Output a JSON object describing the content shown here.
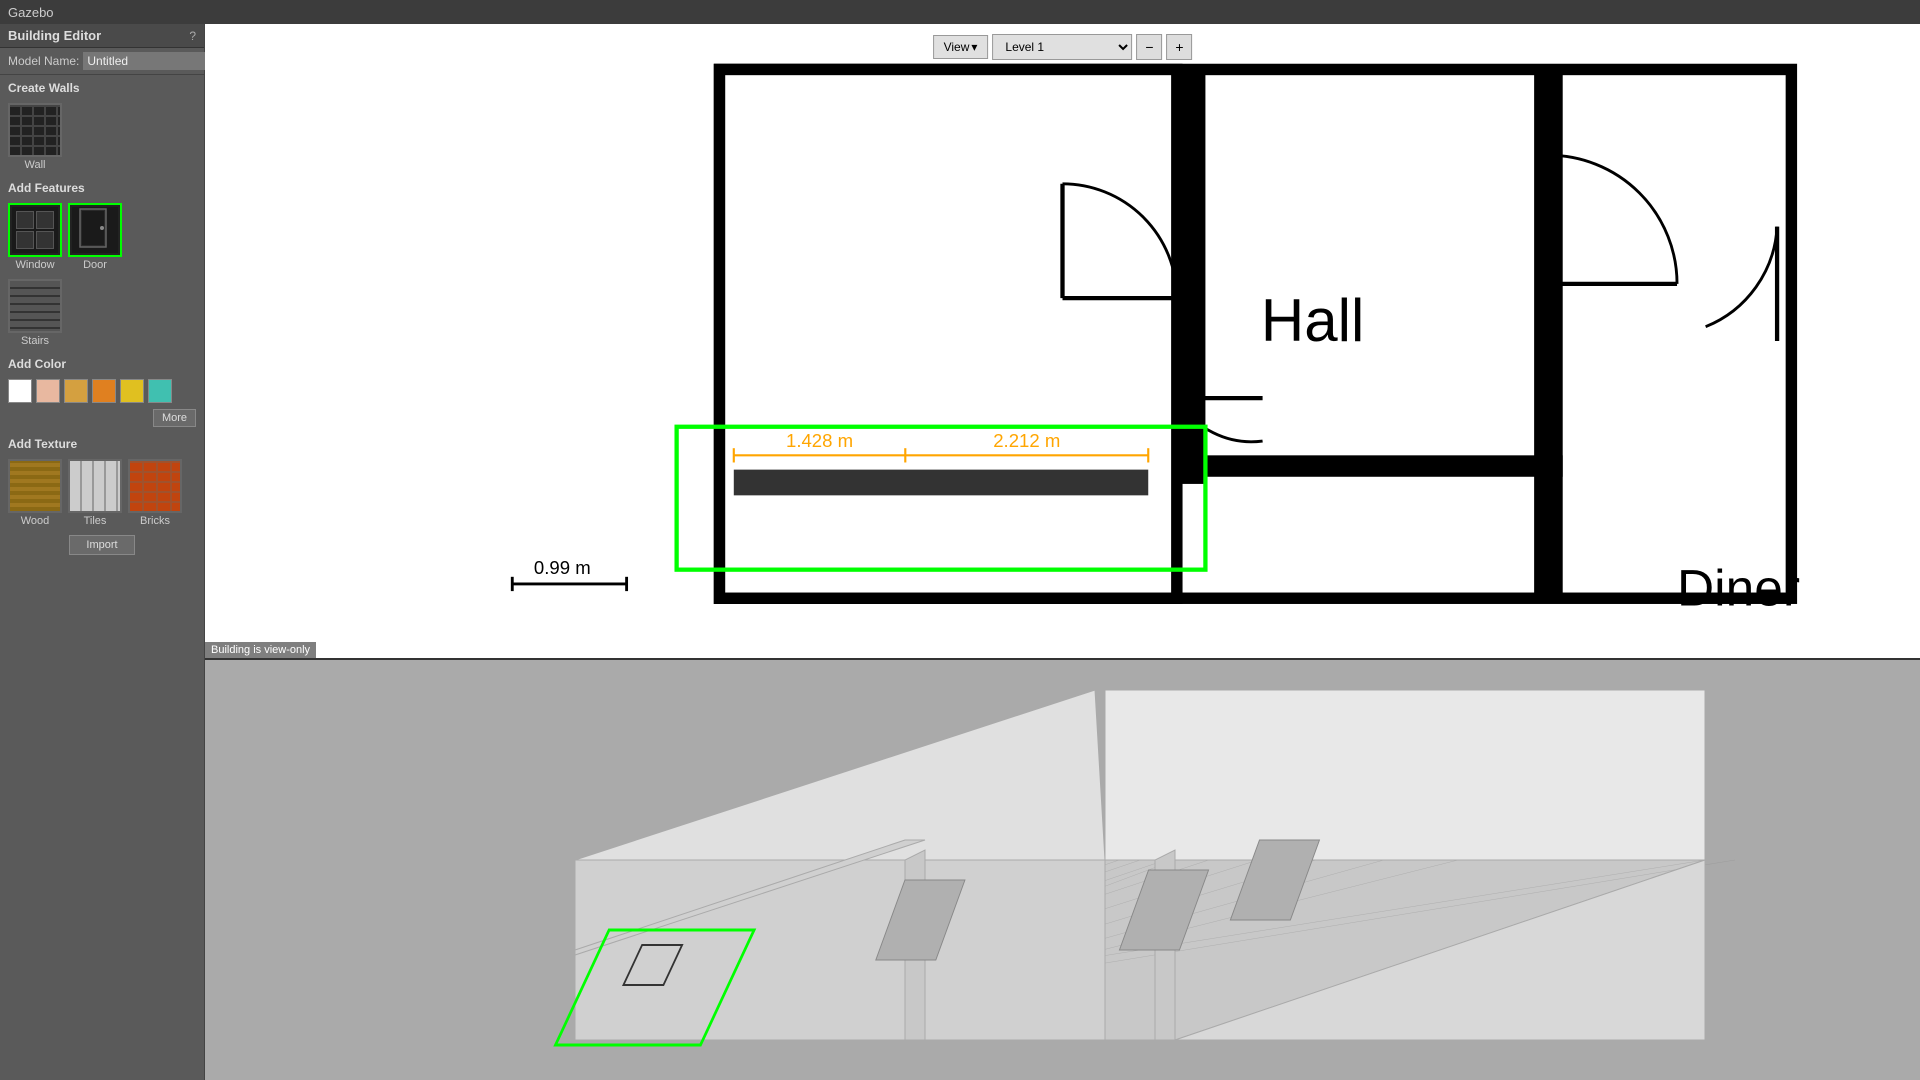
{
  "titlebar": {
    "app_name": "Gazebo"
  },
  "sidebar": {
    "title": "Building Editor",
    "help_label": "?",
    "model_name_label": "Model Name:",
    "model_name_value": "Untitled",
    "sections": {
      "create_walls": "Create Walls",
      "wall_label": "Wall",
      "add_features": "Add Features",
      "window_label": "Window",
      "door_label": "Door",
      "stairs_label": "Stairs",
      "add_color": "Add Color",
      "more_label": "More",
      "add_texture": "Add Texture",
      "wood_label": "Wood",
      "tiles_label": "Tiles",
      "bricks_label": "Bricks",
      "import_label": "Import"
    },
    "colors": [
      "#ffffff",
      "#e8b8a0",
      "#d4a040",
      "#e08020",
      "#e0c020",
      "#40c0b0"
    ]
  },
  "toolbar": {
    "view_label": "View",
    "view_arrow": "▾",
    "level_label": "Level 1",
    "zoom_minus": "−",
    "zoom_plus": "+"
  },
  "floorplan": {
    "scale_label": "0.99 m",
    "hall_label": "Hall",
    "diner_label": "Diner",
    "dimension1": "1.428 m",
    "dimension2": "2.212 m"
  },
  "status": {
    "view_only": "Building is view-only"
  }
}
